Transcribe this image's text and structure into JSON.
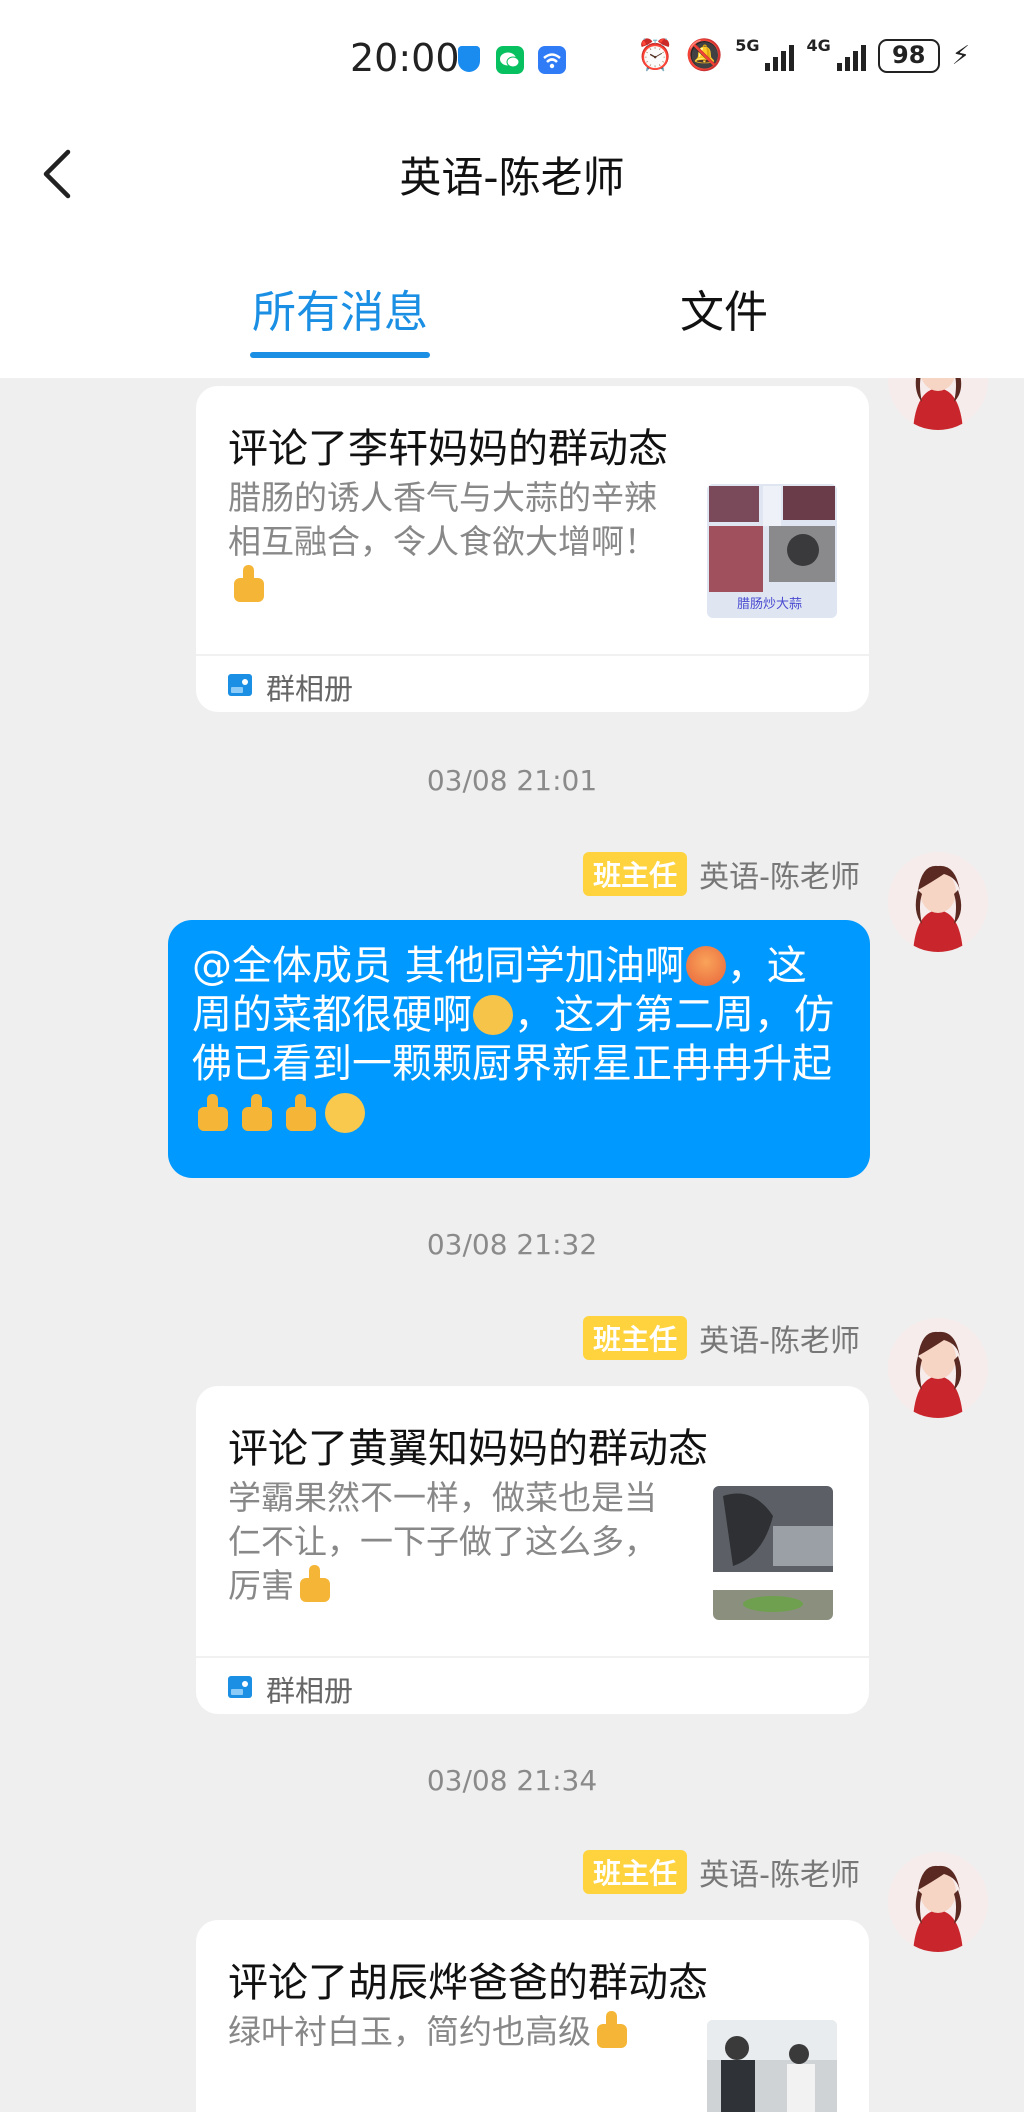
{
  "status_bar": {
    "time": "20:00",
    "network_1": "5G",
    "network_2": "4G",
    "battery": "98"
  },
  "header": {
    "title": "英语-陈老师"
  },
  "tabs": [
    {
      "label": "所有消息",
      "active": true
    },
    {
      "label": "文件",
      "active": false
    }
  ],
  "messages": [
    {
      "card_title": "评论了李轩妈妈的群动态",
      "card_text": "腊肠的诱人香气与大蒜的辛辣相互融合，令人食欲大增啊！",
      "thumb_caption": "腊肠炒大蒜",
      "footer_label": "群相册"
    },
    {
      "timestamp": "03/08 21:01",
      "role_badge": "班主任",
      "sender_name": "英语-陈老师",
      "bubble_parts": [
        "@全体成员 其他同学加油啊",
        "，这周的菜都很硬啊",
        "，这才第二周，仿佛已看到一颗颗厨界新星正冉冉升起"
      ]
    },
    {
      "timestamp": "03/08 21:32",
      "role_badge": "班主任",
      "sender_name": "英语-陈老师",
      "card_title": "评论了黄翼知妈妈的群动态",
      "card_text": "学霸果然不一样，做菜也是当仁不让，一下子做了这么多，厉害",
      "footer_label": "群相册"
    },
    {
      "timestamp": "03/08 21:34",
      "role_badge": "班主任",
      "sender_name": "英语-陈老师",
      "card_title": "评论了胡辰烨爸爸的群动态",
      "card_text": "绿叶衬白玉，简约也高级"
    }
  ],
  "colors": {
    "accent_blue": "#1a8fe3",
    "bubble_blue": "#0099ff",
    "badge_yellow": "#ffd33d",
    "background": "#efefef"
  }
}
